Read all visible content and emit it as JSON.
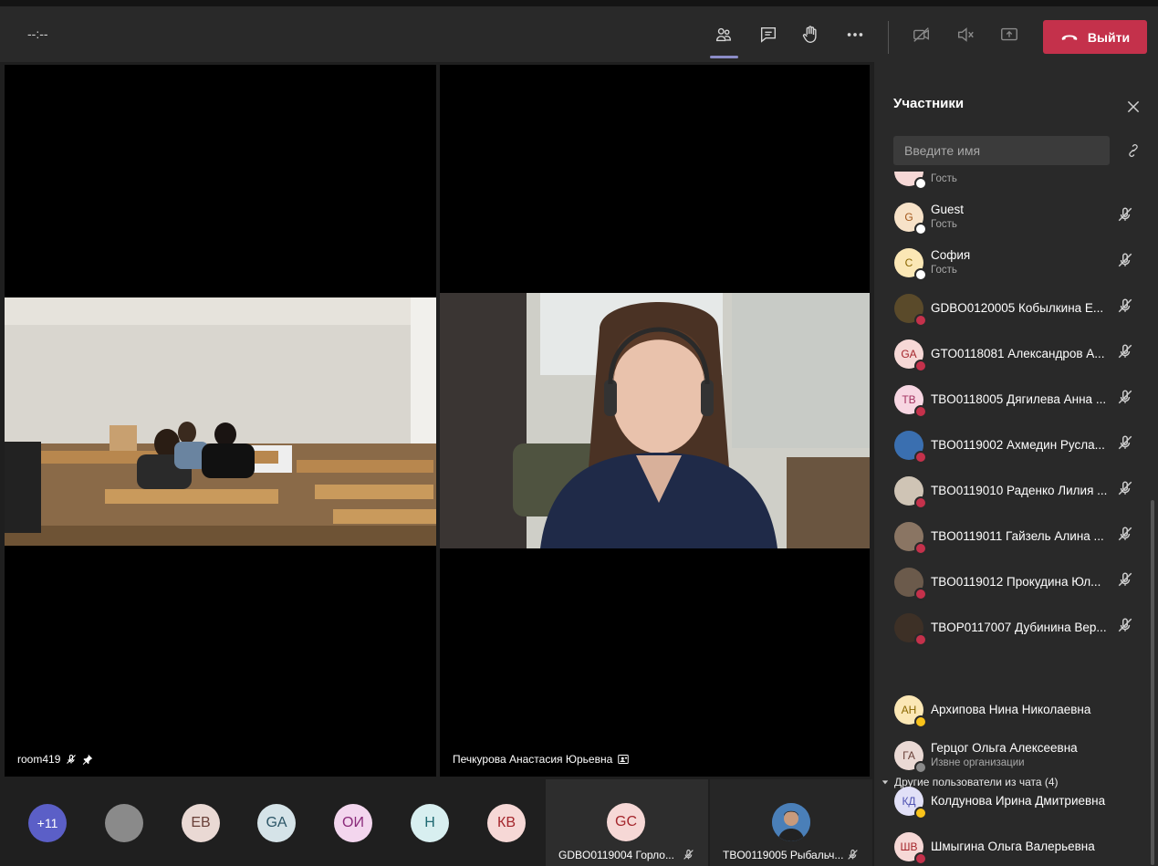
{
  "toolbar": {
    "timer": "--:--",
    "leave_label": "Выйти",
    "colors": {
      "leave": "#c4314b",
      "active": "#8b8cc7"
    }
  },
  "stage": {
    "tile_left_name": "room419",
    "tile_right_name": "Печкурова Анастасия Юрьевна"
  },
  "panel": {
    "title": "Участники",
    "search_placeholder": "Введите имя",
    "partial_subtitle": "Гость",
    "participants": [
      {
        "initials": "G",
        "name": "Guest",
        "sub": "Гость",
        "avatar_bg": "#f7e2c8",
        "avatar_fg": "#a3581c",
        "status": "#ffffff"
      },
      {
        "initials": "С",
        "name": "София",
        "sub": "Гость",
        "avatar_bg": "#fbe7b5",
        "avatar_fg": "#8a6600",
        "status": "#ffffff"
      },
      {
        "initials": "",
        "name": "GDBO0120005 Кобылкина Е...",
        "sub": "",
        "avatar_bg": "#5a4a2a",
        "avatar_fg": "#ffffff",
        "status": "#c4314b"
      },
      {
        "initials": "GA",
        "name": "GTO0118081 Александров А...",
        "sub": "",
        "avatar_bg": "#f6d8d6",
        "avatar_fg": "#a4262c",
        "status": "#c4314b"
      },
      {
        "initials": "ТВ",
        "name": "TBO0118005 Дягилева Анна ...",
        "sub": "",
        "avatar_bg": "#f7d6e2",
        "avatar_fg": "#a33261",
        "status": "#c4314b"
      },
      {
        "initials": "",
        "name": "TBO0119002 Ахмедин Русла...",
        "sub": "",
        "avatar_bg": "#3a6fb0",
        "avatar_fg": "#ffffff",
        "status": "#c4314b"
      },
      {
        "initials": "",
        "name": "TBO0119010 Раденко Лилия ...",
        "sub": "",
        "avatar_bg": "#cfc4b5",
        "avatar_fg": "#ffffff",
        "status": "#c4314b"
      },
      {
        "initials": "",
        "name": "TBO0119011 Гайзель Алина ...",
        "sub": "",
        "avatar_bg": "#8a7563",
        "avatar_fg": "#ffffff",
        "status": "#c4314b"
      },
      {
        "initials": "",
        "name": "TBO0119012 Прокудина Юл...",
        "sub": "",
        "avatar_bg": "#6b5a4b",
        "avatar_fg": "#ffffff",
        "status": "#c4314b"
      },
      {
        "initials": "",
        "name": "TBOP0117007 Дубинина Вер...",
        "sub": "",
        "avatar_bg": "#3d3026",
        "avatar_fg": "#ffffff",
        "status": "#c4314b"
      }
    ],
    "other_section": "Другие пользователи из чата (4)",
    "others": [
      {
        "initials": "АН",
        "name": "Архипова Нина Николаевна",
        "sub": "",
        "avatar_bg": "#fbe7b5",
        "avatar_fg": "#8a6600",
        "status": "#f8c21a"
      },
      {
        "initials": "ГА",
        "name": "Герцог Ольга Алексеевна",
        "sub": "Извне организации",
        "avatar_bg": "#ead9d4",
        "avatar_fg": "#6a4038",
        "status": "#8a8a8a"
      },
      {
        "initials": "КД",
        "name": "Колдунова Ирина Дмитриевна",
        "sub": "",
        "avatar_bg": "#e1e0f7",
        "avatar_fg": "#4f52b2",
        "status": "#f8c21a"
      },
      {
        "initials": "ШВ",
        "name": "Шмыгина Ольга Валерьевна",
        "sub": "",
        "avatar_bg": "#f6d8d6",
        "avatar_fg": "#a4262c",
        "status": "#c4314b"
      }
    ]
  },
  "bottom": {
    "more": "+11",
    "avatars": [
      {
        "initials": "",
        "bg": "#8a8a8a",
        "fg": "#ffffff"
      },
      {
        "initials": "ЕВ",
        "bg": "#ead9d4",
        "fg": "#6a4038"
      },
      {
        "initials": "GA",
        "bg": "#d5e3e8",
        "fg": "#2b5566"
      },
      {
        "initials": "ОИ",
        "bg": "#f3d6ee",
        "fg": "#8a2a7a"
      },
      {
        "initials": "Н",
        "bg": "#d8eff0",
        "fg": "#1f6a72"
      },
      {
        "initials": "КВ",
        "bg": "#f6d8d6",
        "fg": "#a4262c"
      }
    ],
    "card1": {
      "initials": "GC",
      "name": "GDBO0119004 Горло..."
    },
    "card2": {
      "name": "TBO0119005 Рыбальч..."
    }
  }
}
